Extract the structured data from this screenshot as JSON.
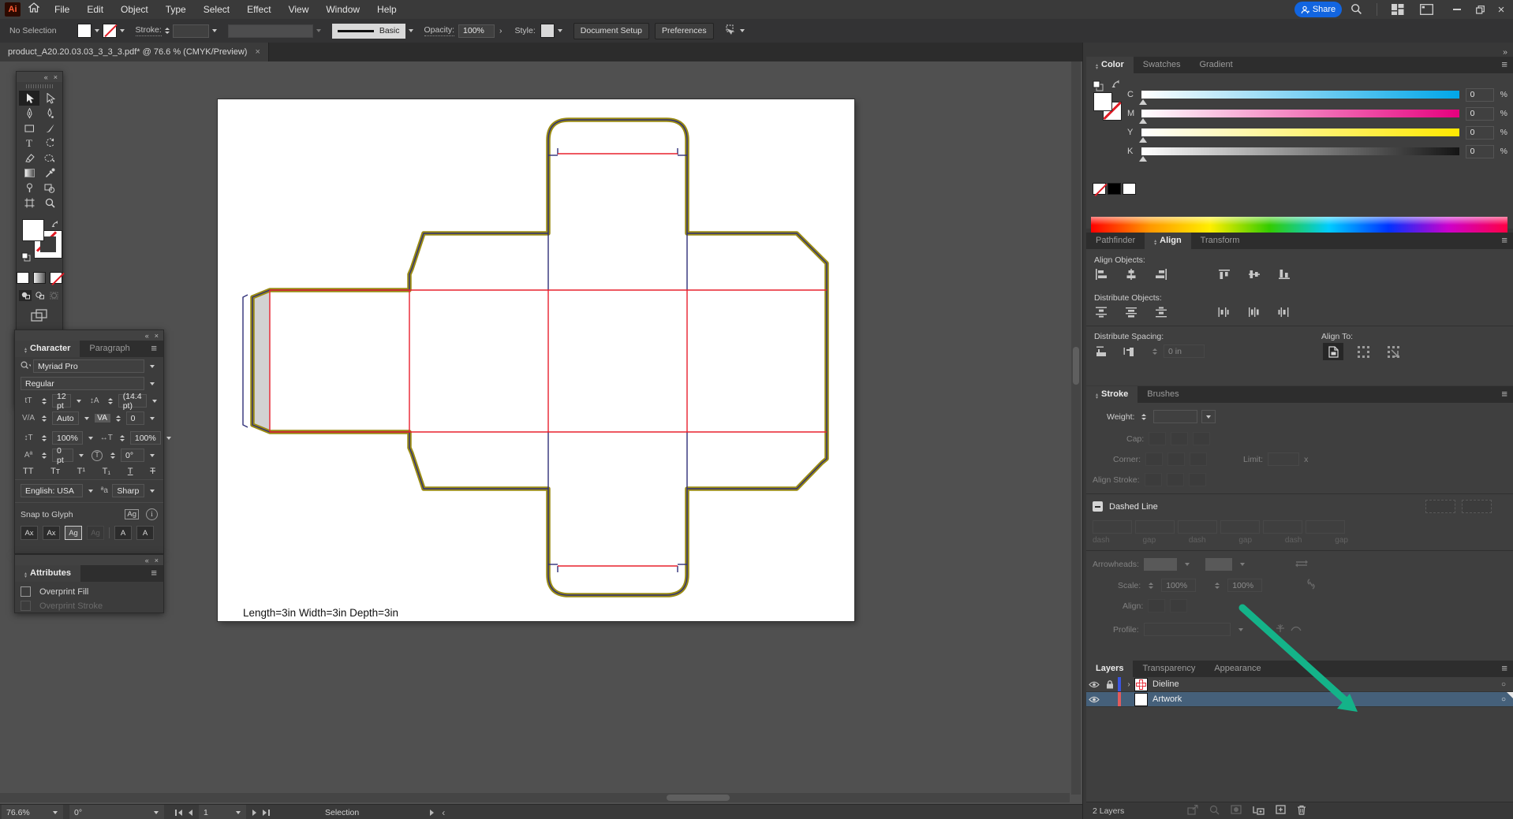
{
  "app": {
    "logo": "Ai",
    "menu": [
      "File",
      "Edit",
      "Object",
      "Type",
      "Select",
      "Effect",
      "View",
      "Window",
      "Help"
    ],
    "share_label": "Share"
  },
  "glyphs": {
    "collapse": "«",
    "expand": "»",
    "close": "×",
    "menu": "≡",
    "more": "…",
    "chevron_right": "›",
    "target": "○",
    "info": "i",
    "limit_x": "x"
  },
  "control_bar": {
    "no_selection": "No Selection",
    "stroke_label": "Stroke:",
    "brush_basic": "Basic",
    "opacity_label": "Opacity:",
    "opacity_value": "100%",
    "style_label": "Style:",
    "document_setup": "Document Setup",
    "preferences": "Preferences"
  },
  "document_tab": {
    "title": "product_A20.20.03.03_3_3_3.pdf* @ 76.6 % (CMYK/Preview)"
  },
  "canvas": {
    "dimension_text": "Length=3in Width=3in Depth=3in"
  },
  "colors": {
    "dieline_outer": "#9a8b13",
    "dieline_cut": "#2f2f78",
    "dieline_crease": "#e8202d",
    "glue_flap_fill": "#d2d2d2",
    "annotation_arrow": "#14b389",
    "share_blue": "#1265e0",
    "layer_dieline_color": "#3b55e0",
    "layer_artwork_color": "#e25c5c"
  },
  "toolbar_tools": [
    "selection",
    "direct-selection",
    "pen",
    "curvature",
    "rectangle",
    "paintbrush",
    "type",
    "rotate",
    "eraser",
    "shaper",
    "gradient",
    "eyedropper",
    "puppet-warp",
    "shape-builder",
    "artboard",
    "zoom"
  ],
  "character_panel": {
    "tab_character": "Character",
    "tab_paragraph": "Paragraph",
    "font_name": "Myriad Pro",
    "font_style": "Regular",
    "size_value": "12 pt",
    "leading_value": "(14.4 pt)",
    "kerning_value": "Auto",
    "tracking_value": "0",
    "v_scale": "100%",
    "h_scale": "100%",
    "baseline_shift": "0 pt",
    "rotation": "0°",
    "language_value": "English: USA",
    "antialias_value": "Sharp",
    "snap_to_glyph": "Snap to Glyph",
    "icons": {
      "size": "tT",
      "leading": "↕A",
      "kerning": "V/A",
      "tracking": "VA",
      "v_scale": "↕T",
      "h_scale": "↔T",
      "baseline": "Aª",
      "rotation": "T",
      "language_aa": "ªa",
      "snap_ag": "Ag"
    },
    "format_icons": [
      "TT",
      "Tᴛ",
      "T¹",
      "T₁",
      "T",
      "T"
    ],
    "snap_icons": [
      "Ax",
      "Ax",
      "Ag",
      "Ag",
      "A",
      "A"
    ]
  },
  "attributes_panel": {
    "tab": "Attributes",
    "overprint_fill": "Overprint Fill",
    "overprint_stroke": "Overprint Stroke"
  },
  "color_panel": {
    "tab_color": "Color",
    "tab_swatches": "Swatches",
    "tab_gradient": "Gradient",
    "channels": [
      {
        "label": "C",
        "value": "0"
      },
      {
        "label": "M",
        "value": "0"
      },
      {
        "label": "Y",
        "value": "0"
      },
      {
        "label": "K",
        "value": "0"
      }
    ],
    "unit": "%"
  },
  "align_panel": {
    "tab_pathfinder": "Pathfinder",
    "tab_align": "Align",
    "tab_transform": "Transform",
    "align_objects_label": "Align Objects:",
    "distribute_objects_label": "Distribute Objects:",
    "distribute_spacing_label": "Distribute Spacing:",
    "align_to_label": "Align To:",
    "spacing_value": "0 in"
  },
  "stroke_panel": {
    "tab_stroke": "Stroke",
    "tab_brushes": "Brushes",
    "weight_label": "Weight:",
    "cap_label": "Cap:",
    "corner_label": "Corner:",
    "limit_label": "Limit:",
    "align_stroke_label": "Align Stroke:",
    "dashed_line_label": "Dashed Line",
    "dash_gap_labels": [
      "dash",
      "gap",
      "dash",
      "gap",
      "dash",
      "gap"
    ],
    "arrowheads_label": "Arrowheads:",
    "scale_label": "Scale:",
    "scale_value_1": "100%",
    "scale_value_2": "100%",
    "align_label": "Align:",
    "profile_label": "Profile:"
  },
  "layers_panel": {
    "tab_layers": "Layers",
    "tab_transparency": "Transparency",
    "tab_appearance": "Appearance",
    "layers": [
      {
        "name": "Dieline",
        "locked": true,
        "visible": true
      },
      {
        "name": "Artwork",
        "locked": false,
        "visible": true,
        "selected": true
      }
    ],
    "status": "2 Layers"
  },
  "status_bar": {
    "zoom": "76.6%",
    "rotation": "0°",
    "artboard": "1",
    "tool": "Selection"
  }
}
